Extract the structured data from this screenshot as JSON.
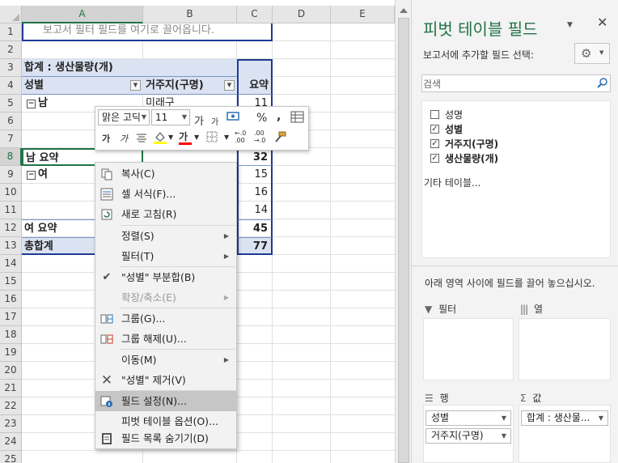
{
  "sheet": {
    "columns": [
      "A",
      "B",
      "C",
      "D",
      "E"
    ],
    "rows": [
      "1",
      "2",
      "3",
      "4",
      "5",
      "6",
      "7",
      "8",
      "9",
      "10",
      "11",
      "12",
      "13",
      "14",
      "15",
      "16",
      "17",
      "18",
      "19",
      "20",
      "21",
      "22",
      "23",
      "24",
      "25"
    ],
    "filter_drop_hint": "보고서 필터 필드를 여기로 끌어옵니다.",
    "pivot_title": "합계 : 생산물량(개)",
    "hdr_gender": "성별",
    "hdr_location": "거주지(구명)",
    "hdr_summary": "요약",
    "male": "남",
    "male_loc": "미래구",
    "male_v1": "11",
    "male_subtotal_label": "남 요약",
    "male_subtotal": "32",
    "female": "여",
    "female_v1": "15",
    "female_v2": "16",
    "female_v3": "14",
    "female_subtotal_label": "여 요약",
    "female_subtotal": "45",
    "grand_total_label": "총합계",
    "grand_total": "77"
  },
  "mini_toolbar": {
    "font_name": "맑은 고딕",
    "font_size": "11",
    "grow_font": "가",
    "shrink_font": "가",
    "percent": "%",
    "comma": ",",
    "bold": "가",
    "italic": "가",
    "font_color_glyph": "가",
    "inc_decimal_a": "←.0",
    "inc_decimal_b": ".00",
    "dec_decimal_a": ".00",
    "dec_decimal_b": "→.0",
    "highlight_color": "#ffff00",
    "font_color": "#ff0000"
  },
  "context_menu": {
    "copy": "복사(C)",
    "format_cells": "셀 서식(F)...",
    "refresh": "새로 고침(R)",
    "sort": "정렬(S)",
    "filter": "필터(T)",
    "subtotal": "\"성별\" 부분합(B)",
    "expand_collapse": "확장/축소(E)",
    "group": "그룹(G)...",
    "ungroup": "그룹 해제(U)...",
    "move": "이동(M)",
    "remove": "\"성별\" 제거(V)",
    "field_settings": "필드 설정(N)...",
    "pivot_options": "피벗 테이블 옵션(O)...",
    "hide_field_list": "필드 목록 숨기기(D)"
  },
  "pane": {
    "title": "피벗 테이블 필드",
    "subtitle": "보고서에 추가할 필드 선택:",
    "search_placeholder": "검색",
    "fields": [
      {
        "label": "성명",
        "checked": false
      },
      {
        "label": "성별",
        "checked": true
      },
      {
        "label": "거주지(구명)",
        "checked": true
      },
      {
        "label": "생산물량(개)",
        "checked": true
      }
    ],
    "more_tables": "기타 테이블...",
    "drag_hint": "아래 영역 사이에 필드를 끌어 놓으십시오.",
    "area_filter": "필터",
    "area_columns": "열",
    "area_rows": "행",
    "area_values": "값",
    "row_field_1": "성별",
    "row_field_2": "거주지(구명)",
    "value_field": "합계 : 생산물..."
  },
  "colors": {
    "accent_green": "#217346",
    "pivot_header": "#dbe3f2",
    "pivot_border": "#1f3a93"
  }
}
